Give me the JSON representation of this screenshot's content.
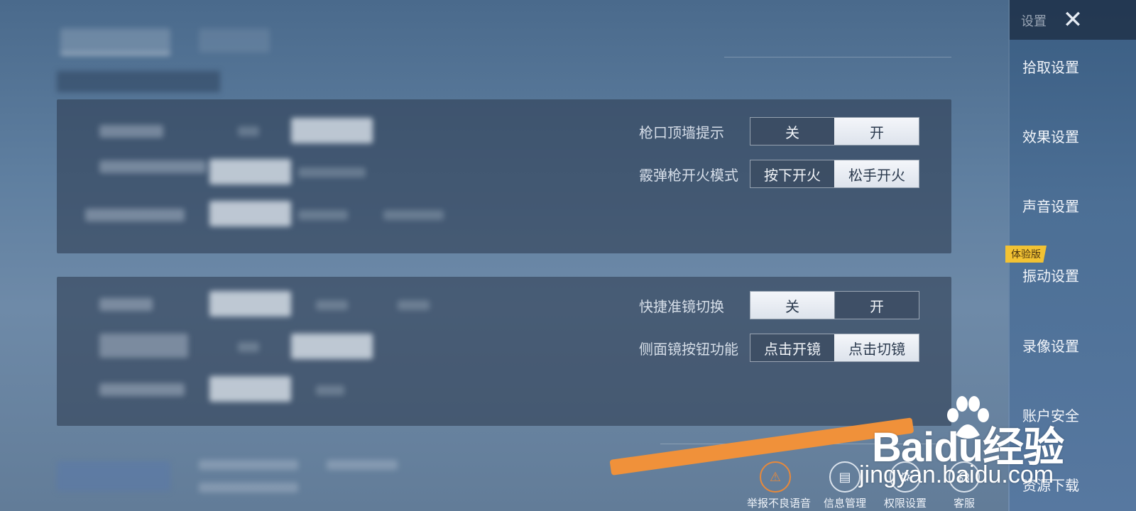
{
  "sidebar": {
    "title": "设置",
    "close_icon": "close-x-icon",
    "trial_badge": "体验版",
    "items": [
      {
        "label": "拾取设置"
      },
      {
        "label": "效果设置"
      },
      {
        "label": "声音设置"
      },
      {
        "label": "振动设置"
      },
      {
        "label": "录像设置"
      },
      {
        "label": "账户安全"
      },
      {
        "label": "资源下载"
      }
    ]
  },
  "panel1": {
    "rows": [
      {
        "label": "枪口顶墙提示",
        "options": [
          "关",
          "开"
        ],
        "selected": 1
      },
      {
        "label": "霰弹枪开火模式",
        "options": [
          "按下开火",
          "松手开火"
        ],
        "selected": 1
      }
    ]
  },
  "panel2": {
    "rows": [
      {
        "label": "快捷准镜切换",
        "options": [
          "关",
          "开"
        ],
        "selected": 0
      },
      {
        "label": "侧面镜按钮功能",
        "options": [
          "点击开镜",
          "点击切镜"
        ],
        "selected": 1
      }
    ]
  },
  "bottom_actions": [
    {
      "label": "举报不良语音",
      "icon": "warning-icon"
    },
    {
      "label": "信息管理",
      "icon": "id-card-icon"
    },
    {
      "label": "权限设置",
      "icon": "gear-icon"
    },
    {
      "label": "客服",
      "icon": "headset-icon"
    }
  ],
  "watermark": {
    "brand": "Baidu经验",
    "url": "jingyan.baidu.com"
  },
  "colors": {
    "background": "#5f7fa0",
    "panel": "#2e3e54",
    "active_option": "#eef1f6",
    "badge": "#f2c233",
    "stripe": "#f0913a"
  }
}
